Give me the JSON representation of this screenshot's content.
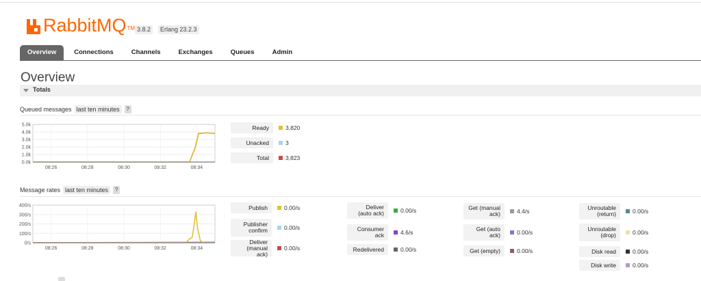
{
  "header": {
    "logo_word": "Rabbit",
    "logo_word2": "MQ",
    "logo_tm": "TM",
    "version": "3.8.2",
    "erlang": "Erlang 23.2.3"
  },
  "nav": {
    "tabs": [
      {
        "label": "Overview",
        "active": true
      },
      {
        "label": "Connections",
        "active": false
      },
      {
        "label": "Channels",
        "active": false
      },
      {
        "label": "Exchanges",
        "active": false
      },
      {
        "label": "Queues",
        "active": false
      },
      {
        "label": "Admin",
        "active": false
      }
    ]
  },
  "page": {
    "title": "Overview",
    "section": "Totals"
  },
  "queued": {
    "label": "Queued messages",
    "range": "last ten minutes",
    "help": "?",
    "chart_data": {
      "type": "line",
      "ylim": [
        0,
        5000
      ],
      "yticks": [
        "5.0k",
        "4.0k",
        "3.0k",
        "2.0k",
        "1.0k",
        "0.0k"
      ],
      "xticks": [
        "08:26",
        "08:28",
        "08:30",
        "08:32",
        "08:34"
      ],
      "xtick_values": [
        26,
        28,
        30,
        32,
        34
      ],
      "xlim": [
        25.0,
        35.0
      ],
      "series": [
        {
          "name": "Ready",
          "color": "#e2c12a",
          "points": [
            [
              25.0,
              0
            ],
            [
              33.6,
              0
            ],
            [
              33.9,
              1800
            ],
            [
              34.1,
              3800
            ],
            [
              34.5,
              3850
            ],
            [
              35.0,
              3820
            ]
          ]
        },
        {
          "name": "Unacked",
          "color": "#a9d3f0",
          "points": [
            [
              25.0,
              0
            ],
            [
              34.6,
              0
            ],
            [
              35.0,
              3
            ]
          ]
        },
        {
          "name": "Total",
          "color": "#c94a4a",
          "points": [
            [
              25.0,
              0
            ],
            [
              33.6,
              0
            ],
            [
              33.9,
              1800
            ],
            [
              34.1,
              3800
            ],
            [
              34.5,
              3850
            ],
            [
              35.0,
              3823
            ]
          ]
        }
      ]
    },
    "stats": [
      {
        "label": "Ready",
        "value": "3,820",
        "color": "#e2c12a"
      },
      {
        "label": "Unacked",
        "value": "3",
        "color": "#a9d3f0"
      },
      {
        "label": "Total",
        "value": "3,823",
        "color": "#c94a4a"
      }
    ]
  },
  "rates": {
    "label": "Message rates",
    "range": "last ten minutes",
    "help": "?",
    "chart_data": {
      "type": "line",
      "ylim": [
        0,
        400
      ],
      "yticks": [
        "400/s",
        "300/s",
        "200/s",
        "100/s",
        "0/s"
      ],
      "xticks": [
        "08:26",
        "08:28",
        "08:30",
        "08:32",
        "08:34"
      ],
      "xtick_values": [
        26,
        28,
        30,
        32,
        34
      ],
      "xlim": [
        25.0,
        35.0
      ],
      "series": [
        {
          "name": "Publish",
          "color": "#e2c12a",
          "points": [
            [
              25.0,
              0
            ],
            [
              33.4,
              0
            ],
            [
              33.6,
              40
            ],
            [
              33.75,
              60
            ],
            [
              33.85,
              180
            ],
            [
              33.95,
              330
            ],
            [
              34.05,
              150
            ],
            [
              34.2,
              20
            ],
            [
              34.4,
              0
            ],
            [
              35.0,
              0
            ]
          ]
        },
        {
          "name": "Consumer ack",
          "color": "#8a3ed8",
          "points": [
            [
              25.0,
              0
            ],
            [
              35.0,
              4.6
            ]
          ]
        },
        {
          "name": "Deliver (manual ack)",
          "color": "#c94a4a",
          "points": [
            [
              25.0,
              0
            ],
            [
              35.0,
              0
            ]
          ]
        }
      ]
    },
    "columns": [
      [
        {
          "label": "Publish",
          "value": "0.00/s",
          "color": "#e2c12a"
        },
        {
          "label": "Publisher confirm",
          "value": "0.00/s",
          "color": "#a9d3f0"
        },
        {
          "label": "Deliver (manual ack)",
          "value": "0.00/s",
          "color": "#c94a4a"
        }
      ],
      [
        {
          "label": "Deliver (auto ack)",
          "value": "0.00/s",
          "color": "#3cab3c"
        },
        {
          "label": "Consumer ack",
          "value": "4.6/s",
          "color": "#8a3ed8"
        },
        {
          "label": "Redelivered",
          "value": "0.00/s",
          "color": "#666666"
        }
      ],
      [
        {
          "label": "Get (manual ack)",
          "value": "4.4/s",
          "color": "#9a9a9a"
        },
        {
          "label": "Get (auto ack)",
          "value": "0.00/s",
          "color": "#7a7ad0"
        },
        {
          "label": "Get (empty)",
          "value": "0.00/s",
          "color": "#8f5a6e"
        }
      ],
      [
        {
          "label": "Unroutable (return)",
          "value": "0.00/s",
          "color": "#5a8a8a"
        },
        {
          "label": "Unroutable (drop)",
          "value": "0.00/s",
          "color": "#e9e3a0"
        },
        {
          "label": "Disk read",
          "value": "0.00/s",
          "color": "#333333"
        },
        {
          "label": "Disk write",
          "value": "0.00/s",
          "color": "#b59ac8"
        }
      ]
    ]
  }
}
